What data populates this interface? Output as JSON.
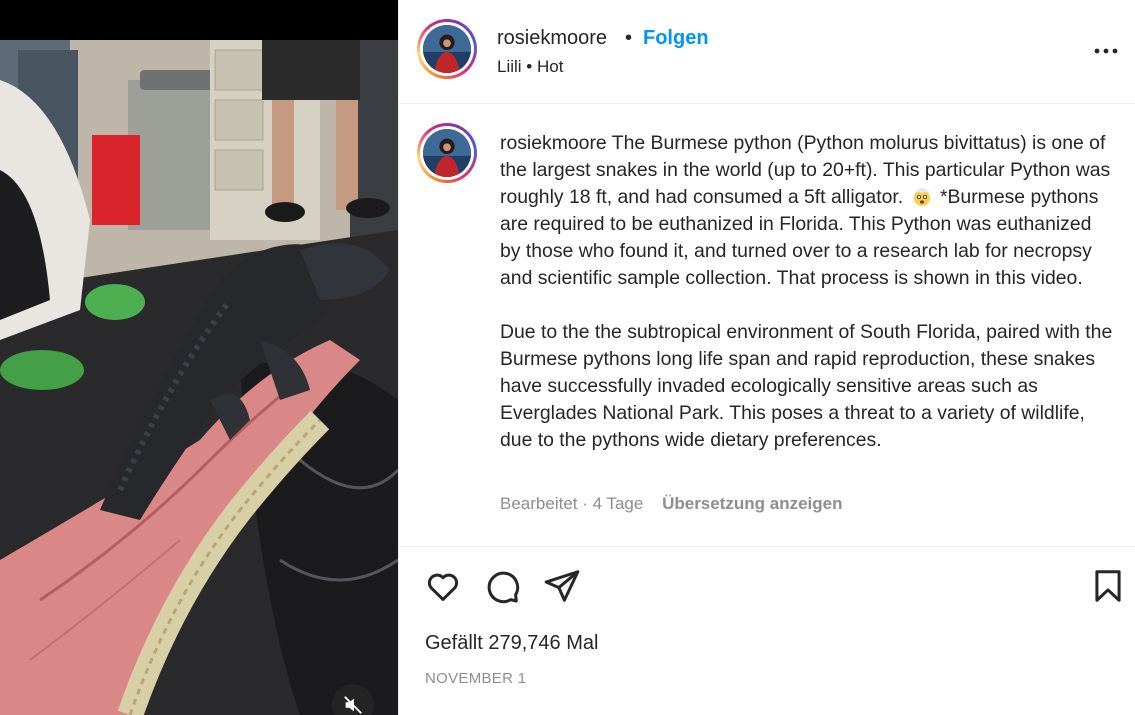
{
  "post": {
    "username": "rosiekmoore",
    "separator": "•",
    "follow_label": "Folgen",
    "audio": "Liili • Hot"
  },
  "caption": {
    "username": "rosiekmoore",
    "paragraph1_part1": " The Burmese python (Python molurus bivittatus) is one of the largest snakes in the world (up to 20+ft). This particular Python was roughly 18 ft, and had consumed a 5ft alligator. ",
    "emoji_name": "exploding-head-emoji",
    "paragraph1_part2": " *Burmese pythons are required to be euthanized in Florida. This Python was euthanized by those who found it, and turned over to a research lab for necropsy and scientific sample collection. That process is shown in this video.",
    "paragraph2": "Due to the the subtropical environment of South Florida, paired with the Burmese pythons long life span and rapid reproduction, these snakes have successfully invaded ecologically sensitive areas such as Everglades National Park. This poses a threat to a variety of wildlife, due to the pythons wide dietary preferences.",
    "edited": "Bearbeitet · 4 Tage",
    "translate_label": "Übersetzung anzeigen"
  },
  "actions": {
    "like_icon": "heart-icon",
    "comment_icon": "comment-icon",
    "share_icon": "paper-plane-icon",
    "save_icon": "bookmark-icon",
    "likes_text": "Gefällt 279,746 Mal",
    "date_text": "NOVEMBER 1"
  },
  "media": {
    "mute_icon": "speaker-muted-icon"
  },
  "colors": {
    "accent": "#0095f6",
    "text": "#262626",
    "secondary": "#8e8e8e",
    "border": "#efefef"
  }
}
